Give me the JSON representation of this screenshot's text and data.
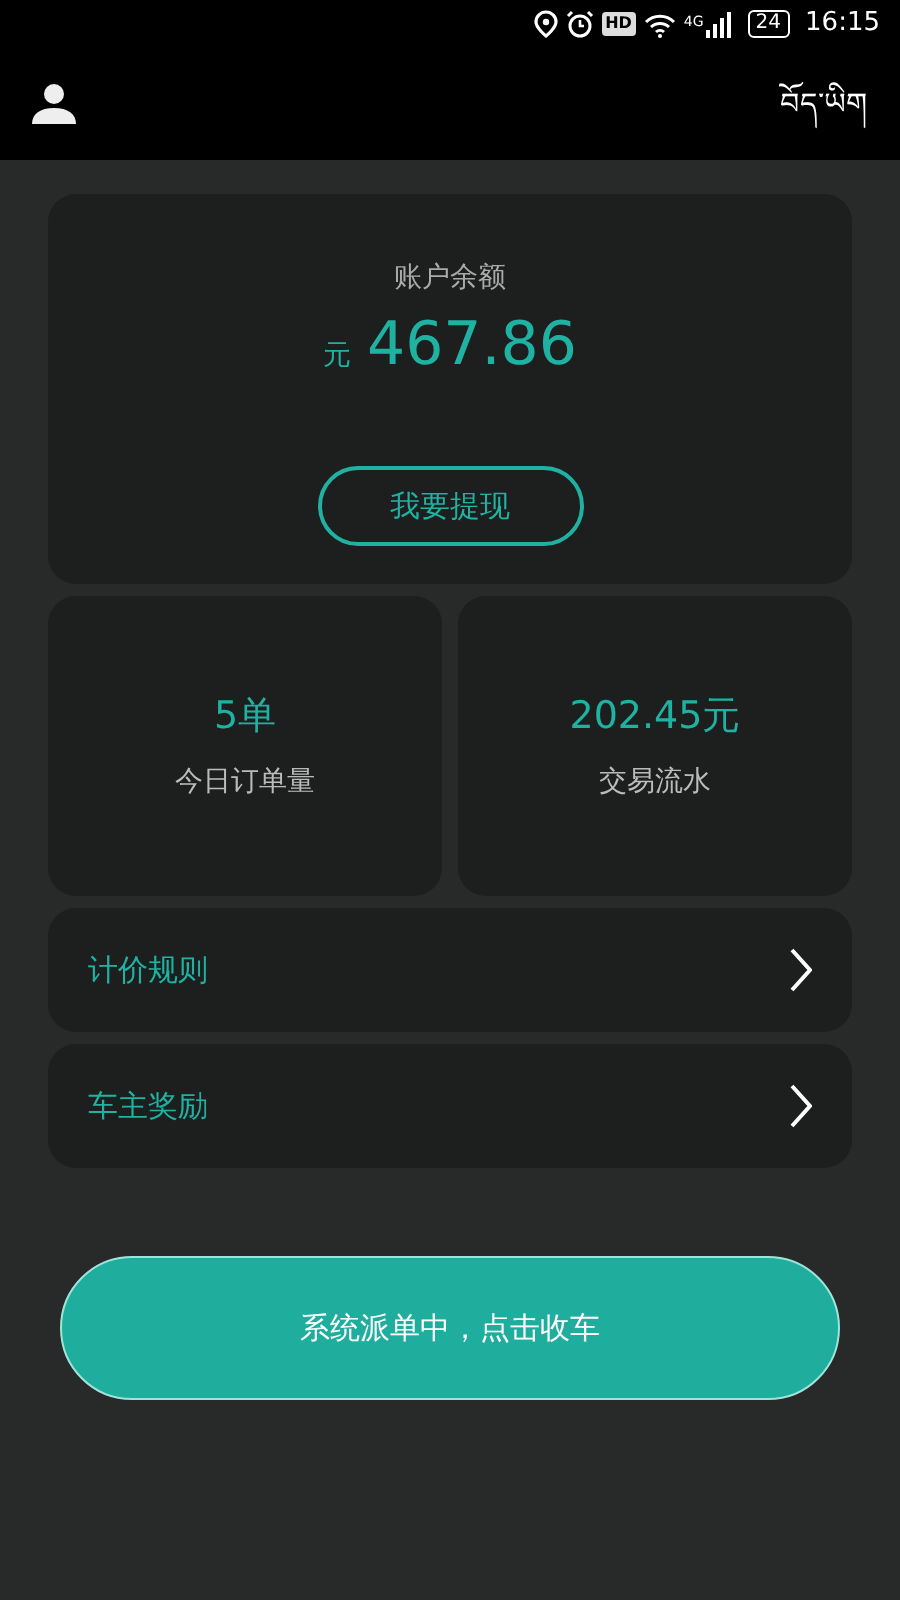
{
  "status_bar": {
    "hd": "HD",
    "network": "4G",
    "battery": "24",
    "time": "16:15"
  },
  "app_bar": {
    "language": "བོད་ཡིག"
  },
  "balance": {
    "label": "账户余额",
    "currency": "元",
    "amount": "467.86",
    "button": "我要提现"
  },
  "stats": [
    {
      "value": "5单",
      "label": "今日订单量"
    },
    {
      "value": "202.45元",
      "label": "交易流水"
    }
  ],
  "menu": [
    {
      "label": "计价规则"
    },
    {
      "label": "车主奖励"
    }
  ],
  "action_button": "系统派单中，点击收车"
}
